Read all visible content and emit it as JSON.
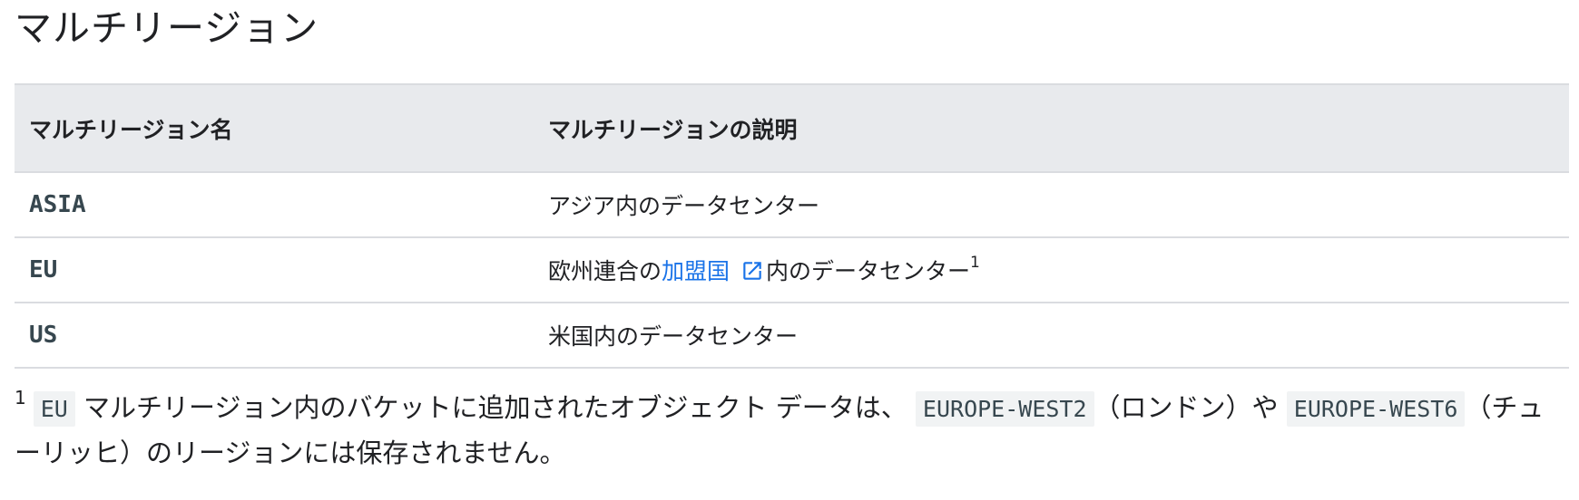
{
  "heading": "マルチリージョン",
  "table": {
    "headers": [
      "マルチリージョン名",
      "マルチリージョンの説明"
    ],
    "rows": [
      {
        "name": "ASIA",
        "description": "アジア内のデータセンター"
      },
      {
        "name": "EU",
        "description_prefix": "欧州連合の",
        "link_text": "加盟国",
        "description_suffix": "内のデータセンター",
        "footnote_ref": "1"
      },
      {
        "name": "US",
        "description": "米国内のデータセンター"
      }
    ]
  },
  "footnote": {
    "number": "1",
    "code_eu": "EU",
    "text_1": " マルチリージョン内のバケットに追加されたオブジェクト データは、",
    "code_london": "EUROPE-WEST2",
    "text_2": "（ロンドン）や",
    "code_zurich": "EUROPE-WEST6",
    "text_3": "（チューリッヒ）のリージョンには保存されません。"
  },
  "icons": {
    "external_link": "external-link-icon"
  },
  "colors": {
    "header_bg": "#e8eaed",
    "border": "#dadce0",
    "link": "#1a73e8",
    "code_bg": "#f1f3f4",
    "code_text": "#37474f",
    "text": "#202124"
  }
}
